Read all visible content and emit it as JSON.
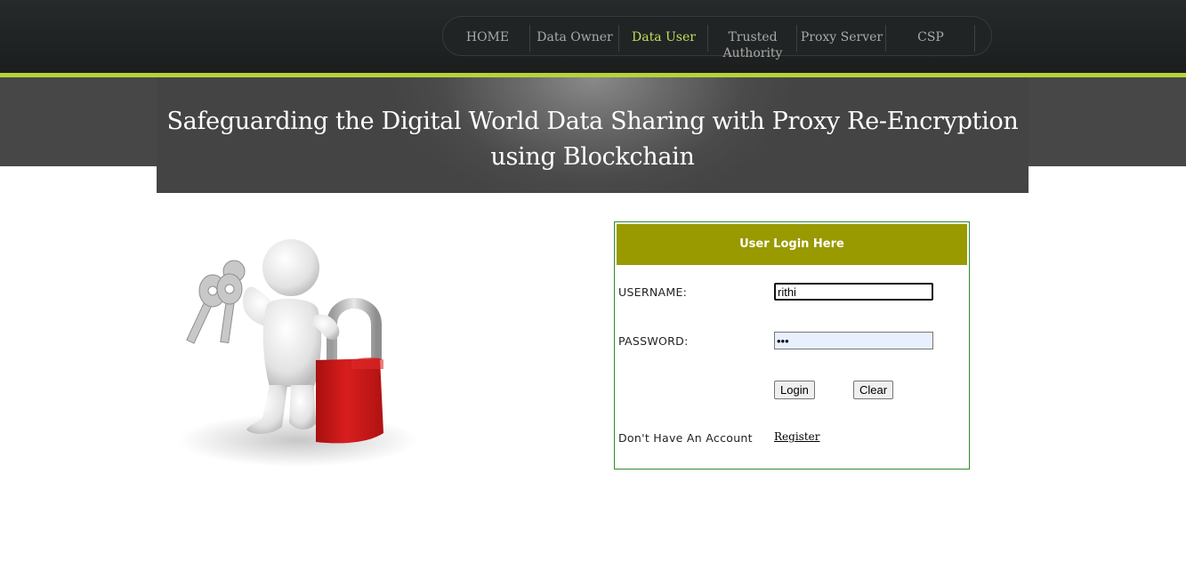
{
  "nav": {
    "items": [
      {
        "label": "HOME",
        "active": false
      },
      {
        "label": "Data Owner",
        "active": false
      },
      {
        "label": "Data User",
        "active": true
      },
      {
        "label": "Trusted Authority",
        "active": false
      },
      {
        "label": "Proxy Server",
        "active": false
      },
      {
        "label": "CSP",
        "active": false
      }
    ]
  },
  "banner": {
    "title_line1": "Safeguarding the Digital World Data Sharing with Proxy Re-Encryption",
    "title_line2": "using Blockchain"
  },
  "illustration": {
    "icon": "user-with-keys-and-padlock-icon"
  },
  "login": {
    "header": "User Login Here",
    "username_label": "USERNAME:",
    "username_value": "rithi",
    "password_label": "PASSWORD:",
    "password_value": "•••",
    "login_button": "Login",
    "clear_button": "Clear",
    "no_account_text": "Don't Have An Account",
    "register_link": "Register"
  },
  "colors": {
    "accent_green": "#b7d23a",
    "active_nav": "#c7dc58",
    "login_header": "#999900",
    "login_border": "#2e8b2e",
    "padlock_red": "#cc1a1a"
  }
}
